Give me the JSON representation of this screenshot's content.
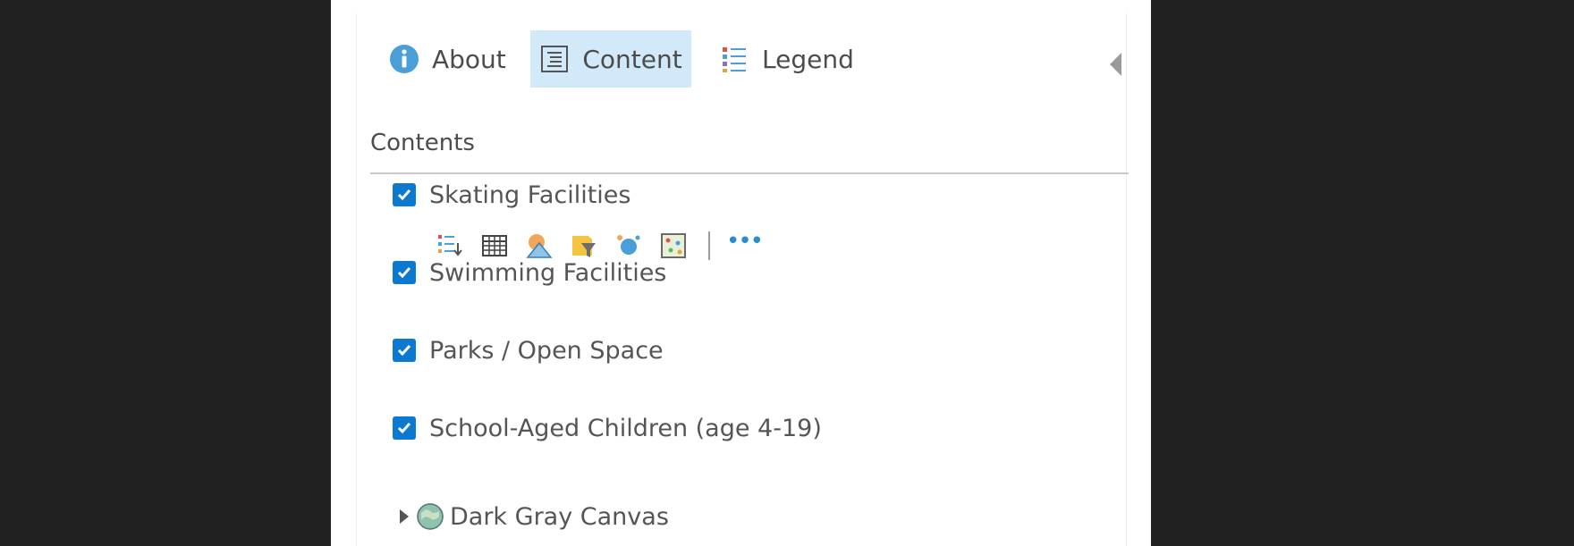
{
  "tabs": {
    "about": "About",
    "content": "Content",
    "legend": "Legend"
  },
  "section_title": "Contents",
  "layers": [
    {
      "label": "Skating Facilities",
      "checked": true
    },
    {
      "label": "Swimming Facilities",
      "checked": true
    },
    {
      "label": "Parks / Open Space",
      "checked": true
    },
    {
      "label": "School-Aged Children (age 4-19)",
      "checked": true
    }
  ],
  "layer_tools": [
    "show-legend-icon",
    "show-table-icon",
    "change-style-icon",
    "filter-icon",
    "perform-analysis-icon",
    "show-item-details-icon",
    "more-options-icon"
  ],
  "more_label": "•••",
  "basemap": {
    "label": "Dark Gray Canvas"
  },
  "colors": {
    "accent": "#0b79d0",
    "active_tab": "#d2e9f9",
    "background": "#212121"
  }
}
